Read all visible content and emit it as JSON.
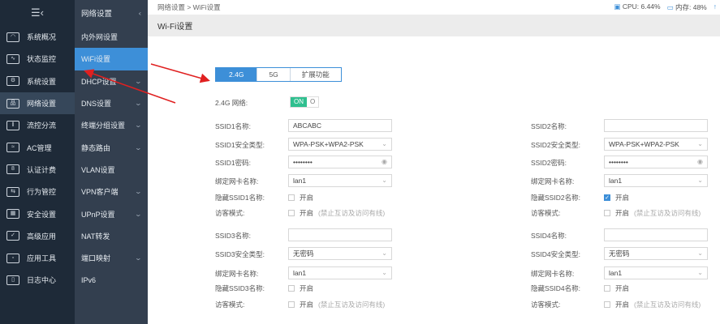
{
  "sidebar": {
    "menu_icon": "hamburger-collapse-icon",
    "items": [
      {
        "label": "系统概况",
        "icon": "gauge-icon"
      },
      {
        "label": "状态监控",
        "icon": "monitor-pulse-icon"
      },
      {
        "label": "系统设置",
        "icon": "gear-icon"
      },
      {
        "label": "网络设置",
        "icon": "network-icon",
        "active": true
      },
      {
        "label": "流控分流",
        "icon": "sliders-icon"
      },
      {
        "label": "AC管理",
        "icon": "wifi-ap-icon"
      },
      {
        "label": "认证计费",
        "icon": "id-card-icon"
      },
      {
        "label": "行为管控",
        "icon": "arrows-icon"
      },
      {
        "label": "安全设置",
        "icon": "firewall-icon"
      },
      {
        "label": "高级应用",
        "icon": "checkbox-icon"
      },
      {
        "label": "应用工具",
        "icon": "apps-icon"
      },
      {
        "label": "日志中心",
        "icon": "document-icon"
      }
    ]
  },
  "submenu": {
    "title": "网络设置",
    "items": [
      {
        "label": "内外网设置",
        "chevron": false
      },
      {
        "label": "WiFi设置",
        "chevron": false,
        "active": true
      },
      {
        "label": "DHCP设置",
        "chevron": true
      },
      {
        "label": "DNS设置",
        "chevron": true
      },
      {
        "label": "终端分组设置",
        "chevron": true
      },
      {
        "label": "静态路由",
        "chevron": true
      },
      {
        "label": "VLAN设置",
        "chevron": false
      },
      {
        "label": "VPN客户端",
        "chevron": true
      },
      {
        "label": "UPnP设置",
        "chevron": true
      },
      {
        "label": "NAT转发",
        "chevron": false
      },
      {
        "label": "端口映射",
        "chevron": true
      },
      {
        "label": "IPv6",
        "chevron": false
      }
    ]
  },
  "header": {
    "breadcrumb": "网络设置 > WiFi设置",
    "cpu": "CPU: 6.44%",
    "memory": "内存: 48%",
    "title": "Wi-Fi设置"
  },
  "tabs": [
    "2.4G",
    "5G",
    "扩展功能"
  ],
  "network_toggle": {
    "label": "2.4G 网络:",
    "on": "ON",
    "off": "O"
  },
  "labels": {
    "open": "开启",
    "guest_note": "(禁止互访及访问有线)"
  },
  "ssids": [
    {
      "name_label": "SSID1名称:",
      "name": "ABCABC",
      "sec_label": "SSID1安全类型:",
      "security": "WPA-PSK+WPA2-PSK",
      "pwd_label": "SSID1密码:",
      "password": "••••••••",
      "bind_label": "绑定网卡名称:",
      "bind": "lan1",
      "hide_label": "隐藏SSID1名称:",
      "hidden": false,
      "guest_label": "访客模式:"
    },
    {
      "name_label": "SSID2名称:",
      "name": "",
      "sec_label": "SSID2安全类型:",
      "security": "WPA-PSK+WPA2-PSK",
      "pwd_label": "SSID2密码:",
      "password": "••••••••",
      "bind_label": "绑定网卡名称:",
      "bind": "lan1",
      "hide_label": "隐藏SSID2名称:",
      "hidden": true,
      "guest_label": "访客模式:"
    },
    {
      "name_label": "SSID3名称:",
      "name": "",
      "sec_label": "SSID3安全类型:",
      "security": "无密码",
      "bind_label": "绑定网卡名称:",
      "bind": "lan1",
      "hide_label": "隐藏SSID3名称:",
      "hidden": false,
      "guest_label": "访客模式:"
    },
    {
      "name_label": "SSID4名称:",
      "name": "",
      "sec_label": "SSID4安全类型:",
      "security": "无密码",
      "bind_label": "绑定网卡名称:",
      "bind": "lan1",
      "hide_label": "隐藏SSID4名称:",
      "hidden": false,
      "guest_label": "访客模式:"
    }
  ],
  "colors": {
    "accent": "#3d8fd8",
    "toggle_on": "#2fbf8f",
    "annotation_arrow": "#e02020"
  }
}
